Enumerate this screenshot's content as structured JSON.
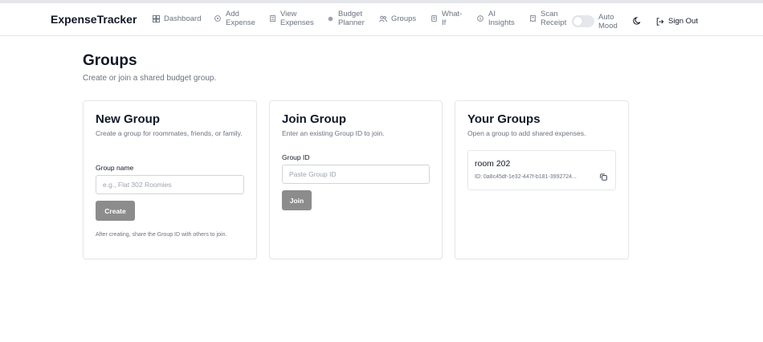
{
  "app": {
    "brand": "ExpenseTracker"
  },
  "nav": {
    "items": [
      {
        "label": "Dashboard",
        "icon": "dashboard-icon"
      },
      {
        "label": "Add Expense",
        "icon": "plus-circle-icon"
      },
      {
        "label": "View Expenses",
        "icon": "list-icon"
      },
      {
        "label": "Budget Planner",
        "icon": "dot-icon"
      },
      {
        "label": "Groups",
        "icon": "users-icon"
      },
      {
        "label": "What-If",
        "icon": "calculator-icon"
      },
      {
        "label": "AI Insights",
        "icon": "info-circle-icon"
      },
      {
        "label": "Scan Receipt",
        "icon": "receipt-icon"
      }
    ],
    "auto_mood": "Auto Mood",
    "auto_mood_enabled": false,
    "sign_out": "Sign Out"
  },
  "page": {
    "title": "Groups",
    "subtitle": "Create or join a shared budget group."
  },
  "new_group": {
    "title": "New Group",
    "subtitle": "Create a group for roommates, friends, or family.",
    "name_label": "Group name",
    "name_placeholder": "e.g., Flat 302 Roomies",
    "name_value": "",
    "create_label": "Create",
    "hint": "After creating, share the Group ID with others to join."
  },
  "join_group": {
    "title": "Join Group",
    "subtitle": "Enter an existing Group ID to join.",
    "id_label": "Group ID",
    "id_placeholder": "Paste Group ID",
    "id_value": "",
    "join_label": "Join"
  },
  "your_groups": {
    "title": "Your Groups",
    "subtitle": "Open a group to add shared expenses.",
    "groups": [
      {
        "name": "room 202",
        "id_text": "ID: 0a8c45df-1e32-447f-b181-3992724..."
      }
    ]
  },
  "colors": {
    "button_disabled": "#8c8c8c",
    "border": "#e5e7eb",
    "muted_text": "#6b7280",
    "text": "#111827"
  }
}
